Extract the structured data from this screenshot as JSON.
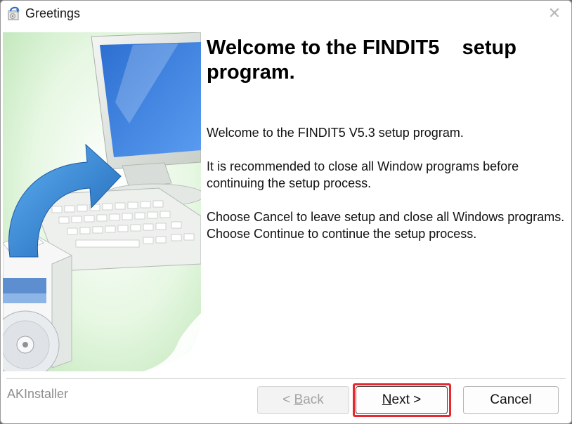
{
  "window": {
    "title": "Greetings",
    "close_glyph": "✕"
  },
  "main": {
    "heading": "Welcome to the FINDIT5    setup program.",
    "paragraphs": [
      "Welcome to the FINDIT5 V5.3 setup program.",
      "It is recommended to close all Window programs before continuing the setup process.",
      "Choose Cancel to leave setup and close all Windows programs. Choose Continue to continue the setup process."
    ]
  },
  "footer": {
    "brand": "AKInstaller",
    "back": {
      "prefix": "< ",
      "accel": "B",
      "rest": "ack"
    },
    "next": {
      "accel": "N",
      "rest": "ext >"
    },
    "cancel": "Cancel"
  },
  "icons": [
    "setup-app-icon",
    "close-icon",
    "computer-installer-illustration"
  ],
  "colors": {
    "highlight": "#e8282f",
    "banner_green": "#cfeec9"
  }
}
